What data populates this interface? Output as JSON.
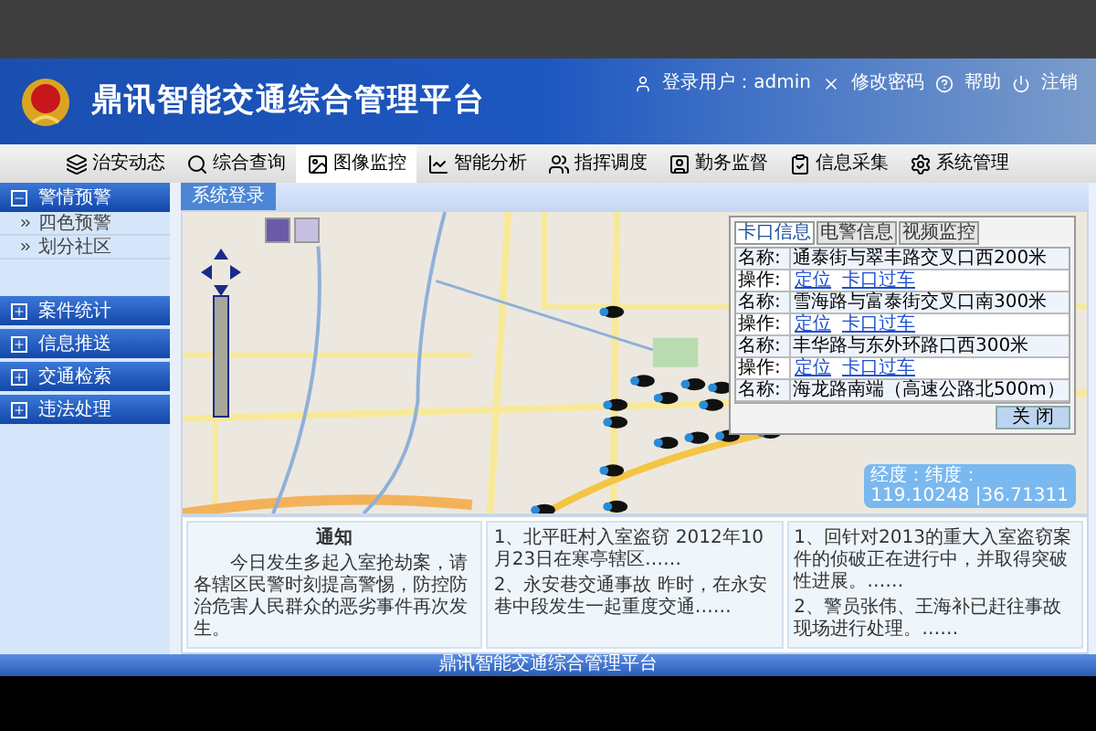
{
  "header": {
    "title": "鼎讯智能交通综合管理平台",
    "user_label": "登录用户：admin",
    "links": [
      {
        "kind": "password",
        "label": "修改密码"
      },
      {
        "kind": "help",
        "label": "帮助"
      },
      {
        "kind": "logout",
        "label": "注销"
      }
    ]
  },
  "nav": [
    {
      "label": "治安动态",
      "selected": false
    },
    {
      "label": "综合查询",
      "selected": false
    },
    {
      "label": "图像监控",
      "selected": true
    },
    {
      "label": "智能分析",
      "selected": false
    },
    {
      "label": "指挥调度",
      "selected": false
    },
    {
      "label": "勤务监督",
      "selected": false
    },
    {
      "label": "信息采集",
      "selected": false
    },
    {
      "label": "系统管理",
      "selected": false
    }
  ],
  "sidebar": [
    {
      "label": "警情预警",
      "expanded": true,
      "children": [
        {
          "label": "四色预警"
        },
        {
          "label": "划分社区"
        }
      ]
    },
    {
      "label": "案件统计",
      "expanded": false
    },
    {
      "label": "信息推送",
      "expanded": false
    },
    {
      "label": "交通检索",
      "expanded": false
    },
    {
      "label": "违法处理",
      "expanded": false
    }
  ],
  "content_tab": {
    "label": "系统登录"
  },
  "popup": {
    "tabs": [
      {
        "label": "卡口信息",
        "selected": true
      },
      {
        "label": "电警信息",
        "selected": false
      },
      {
        "label": "视频监控",
        "selected": false
      }
    ],
    "rows": [
      {
        "kind": "name",
        "key": "名称:",
        "value": "通泰街与翠丰路交叉口西200米"
      },
      {
        "kind": "ops",
        "key": "操作:",
        "links": [
          "定位",
          "卡口过车"
        ]
      },
      {
        "kind": "name",
        "key": "名称:",
        "value": "雪海路与富泰街交叉口南300米"
      },
      {
        "kind": "ops",
        "key": "操作:",
        "links": [
          "定位",
          "卡口过车"
        ]
      },
      {
        "kind": "name",
        "key": "名称:",
        "value": "丰华路与东外环路口西300米"
      },
      {
        "kind": "ops",
        "key": "操作:",
        "links": [
          "定位",
          "卡口过车"
        ]
      },
      {
        "kind": "name",
        "key": "名称:",
        "value": "海龙路南端（高速公路北500m）"
      }
    ],
    "close_button": "关 闭"
  },
  "coords": {
    "label": "经度：纬度：",
    "value": "119.10248 |36.71311"
  },
  "notices": [
    {
      "kind": "article",
      "title": "通知",
      "text": "今日发生多起入室抢劫案，请各辖区民警时刻提高警惕，防控防治危害人民群众的恶劣事件再次发生。"
    },
    {
      "kind": "list",
      "items": [
        "1、北平旺村入室盗窃 2012年10月23日在寒亭辖区……",
        "2、永安巷交通事故 昨时，在永安巷中段发生一起重度交通……"
      ]
    },
    {
      "kind": "list",
      "items": [
        "1、回针对2013的重大入室盗窃案件的侦破正在进行中，并取得突破性进展。……",
        "2、警员张伟、王海补已赶往事故现场进行处理。……"
      ]
    }
  ],
  "footer": "鼎讯智能交通综合管理平台"
}
